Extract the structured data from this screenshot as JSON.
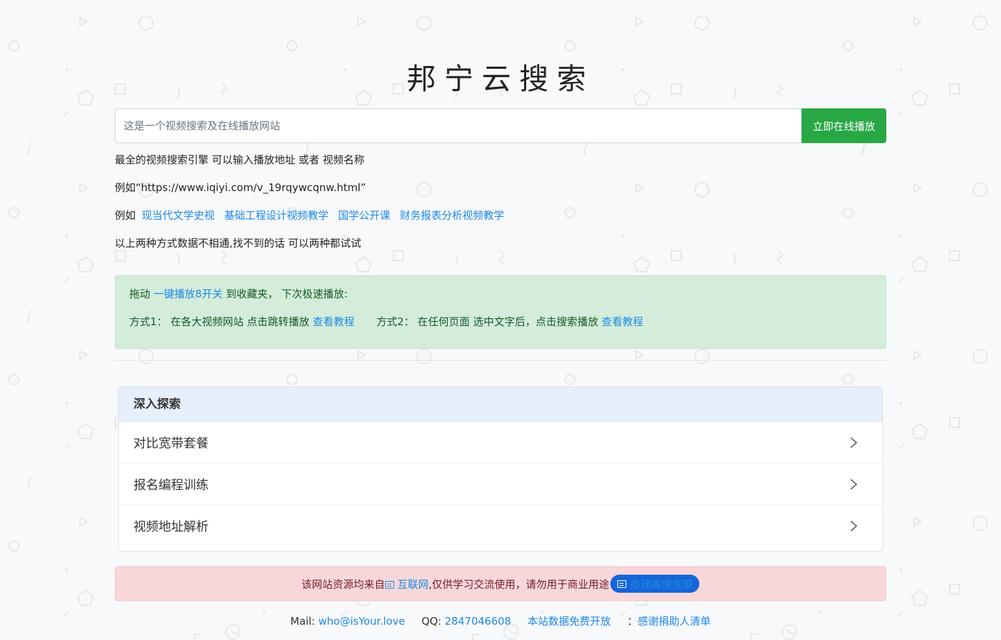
{
  "header": {
    "title": "邦宁云搜索"
  },
  "search": {
    "placeholder": "这是一个视频搜索及在线播放网站",
    "value": "",
    "button_label": "立即在线播放"
  },
  "hints": {
    "line1": "最全的视频搜索引擎 可以输入播放地址 或者 视频名称",
    "line2": "例如“https://www.iqiyi.com/v_19rqywcqnw.html”",
    "line3_prefix": "例如",
    "examples": [
      "现当代文学史视",
      "基础工程设计视频教学",
      "国学公开课",
      "财务报表分析视频教学"
    ],
    "line4": "以上两种方式数据不相通,找不到的话 可以两种都试试"
  },
  "tip": {
    "drag_prefix": "拖动",
    "drag_link": "一键播放8开关",
    "drag_suffix": "到收藏夹， 下次极速播放:",
    "method1_label": "方式1：",
    "method1_text": "在各大视频网站 点击跳转播放",
    "method1_link": "查看教程",
    "method2_label": "方式2：",
    "method2_text": "在任何页面 选中文字后，点击搜索播放",
    "method2_link": "查看教程"
  },
  "explore": {
    "header": "深入探索",
    "items": [
      {
        "label": "对比宽带套餐"
      },
      {
        "label": "报名编程训练"
      },
      {
        "label": "视频地址解析"
      }
    ]
  },
  "notice": {
    "prefix": "该网站资源均来自",
    "link": "互联网",
    "middle": ",仅供学习交流使用，请勿用于商业用途",
    "button": "办理高速宽带"
  },
  "footer": {
    "mail_label": "Mail:",
    "mail": "who@isYour.love",
    "qq_label": "QQ:",
    "qq": "2847046608",
    "open_data": "本站数据免费开放",
    "thanks_prefix": "：",
    "thanks": "感谢捐助人清单"
  },
  "colors": {
    "background": "#f8f9fb",
    "primary_button": "#28a745",
    "link": "#1e88e5",
    "success_bg": "#d4edda",
    "danger_bg": "#f8d7da",
    "card_header_bg": "#e7effc",
    "pill_bg": "#1565d8"
  },
  "icons": {
    "chevron": "chevron-right-icon",
    "doc": "document-icon"
  }
}
